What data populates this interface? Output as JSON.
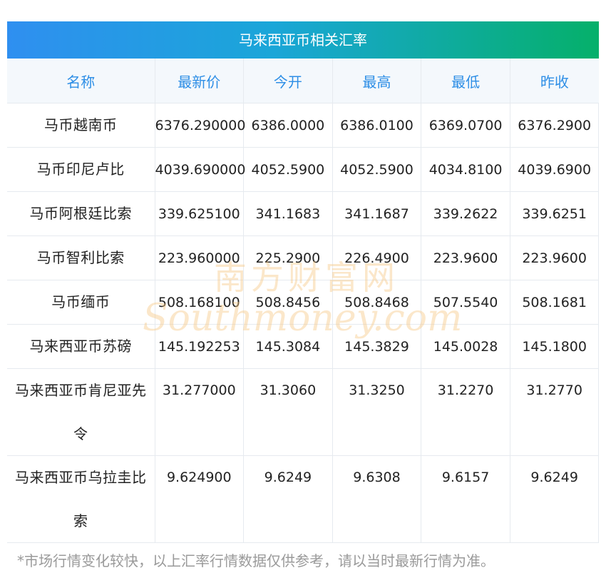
{
  "table_title": "马来西亚币相关汇率",
  "columns": [
    "名称",
    "最新价",
    "今开",
    "最高",
    "最低",
    "昨收"
  ],
  "rows": [
    {
      "name": "马币越南币",
      "latest": "6376.290000",
      "open": "6386.0000",
      "high": "6386.0100",
      "low": "6369.0700",
      "prev": "6376.2900"
    },
    {
      "name": "马币印尼卢比",
      "latest": "4039.690000",
      "open": "4052.5900",
      "high": "4052.5900",
      "low": "4034.8100",
      "prev": "4039.6900"
    },
    {
      "name": "马币阿根廷比索",
      "latest": "339.625100",
      "open": "341.1683",
      "high": "341.1687",
      "low": "339.2622",
      "prev": "339.6251"
    },
    {
      "name": "马币智利比索",
      "latest": "223.960000",
      "open": "225.2900",
      "high": "226.4900",
      "low": "223.9600",
      "prev": "223.9600"
    },
    {
      "name": "马币缅币",
      "latest": "508.168100",
      "open": "508.8456",
      "high": "508.8468",
      "low": "507.5540",
      "prev": "508.1681"
    },
    {
      "name": "马来西亚币苏磅",
      "latest": "145.192253",
      "open": "145.3084",
      "high": "145.3829",
      "low": "145.0028",
      "prev": "145.1800"
    },
    {
      "name_line1": "马来西亚币肯尼亚先",
      "name_line2": "令",
      "latest": "31.277000",
      "open": "31.3060",
      "high": "31.3250",
      "low": "31.2270",
      "prev": "31.2770"
    },
    {
      "name_line1": "马来西亚币乌拉圭比",
      "name_line2": "索",
      "latest": "9.624900",
      "open": "9.6249",
      "high": "9.6308",
      "low": "9.6157",
      "prev": "9.6249"
    }
  ],
  "watermark": {
    "cn": "南方财富网",
    "en": "Southmoney.com",
    "color": "#f6c98a"
  },
  "footnote": "*市场行情变化较快，以上汇率行情数据仅供参考，请以当时最新行情为准。",
  "colors": {
    "header_text": "#2d8ee6",
    "title_grad_start": "#2f8ff0",
    "title_grad_end": "#05b06a"
  }
}
